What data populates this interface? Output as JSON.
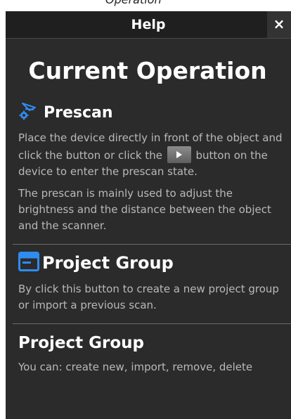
{
  "top_strip_text": "Operation",
  "header": {
    "title": "Help",
    "close_label": "×"
  },
  "main_heading": "Current Operation",
  "sections": [
    {
      "title": "Prescan",
      "icon": "prescan-icon",
      "paragraph_1_before": "Place the device directly in front of the object and click the button or click the",
      "paragraph_1_after": "button on the device to enter the prescan state.",
      "paragraph_2": "The prescan is mainly used to adjust the brightness and the distance between the object and the scanner."
    },
    {
      "title": "Project Group",
      "icon": "project-group-icon",
      "paragraph_1": "By click this button to create a new project group or import a previous scan."
    },
    {
      "title": "Project Group",
      "paragraph_1": "You can: create new, import, remove, delete"
    }
  ],
  "colors": {
    "panel_bg": "#2b2b2b",
    "header_bg": "#1f1f1f",
    "accent_blue": "#2f8cf0",
    "body_text": "#b9b9b9"
  }
}
